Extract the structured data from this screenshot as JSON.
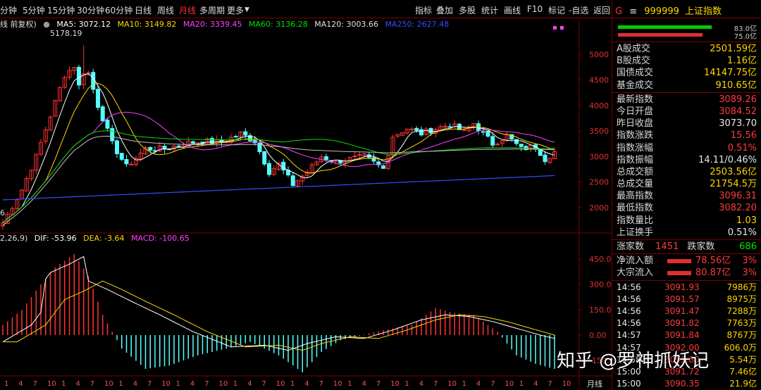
{
  "toolbar": {
    "left_items": [
      "分钟",
      "5分钟",
      "15分钟",
      "30分钟",
      "60分钟",
      "日线",
      "周线",
      "月线",
      "多周期",
      "更多"
    ],
    "active": "月线",
    "right_items": [
      "指标",
      "叠加",
      "多股",
      "统计",
      "画线",
      "F10",
      "标记",
      "-自选",
      "返回"
    ]
  },
  "price_legend": {
    "prefix": "线 前复权)",
    "ma5": "MA5: 3072.12",
    "ma10": "MA10: 3149.82",
    "ma20": "MA20: 3339.45",
    "ma60": "MA60: 3136.28",
    "ma120": "MA120: 3003.66",
    "ma250": "MA250: 2627.48",
    "peak_label": "5178.19",
    "low_label": "6"
  },
  "macd_legend": {
    "prefix": "2,26,9)",
    "dif": "DIF: -53.96",
    "dea": "DEA: -3.64",
    "macd": "MACD: -100.65"
  },
  "price_axis": [
    "5000",
    "4500",
    "4000",
    "3500",
    "3000",
    "2500",
    "2000"
  ],
  "macd_axis": [
    "450.0",
    "300.0",
    "150.0",
    "0.00",
    "-150.0"
  ],
  "x_axis": [
    "1",
    "4",
    "7",
    "10",
    "1",
    "4",
    "7",
    "10",
    "1",
    "4",
    "7",
    "10",
    "1",
    "4",
    "7",
    "10",
    "1",
    "4",
    "7",
    "10",
    "1",
    "4",
    "7",
    "10",
    "1",
    "4",
    "7",
    "10",
    "1",
    "4",
    "7",
    "10",
    "1",
    "4",
    "7",
    "10",
    "1",
    "4",
    "7",
    "10"
  ],
  "period_label": "月线",
  "panel": {
    "g": "G",
    "menu": "≡",
    "code": "999999",
    "name": "上证指数",
    "strength": [
      {
        "color": "#00cc00",
        "fraction": 0.83,
        "pct": "83.0亿"
      },
      {
        "color": "#e03030",
        "fraction": 0.75,
        "pct": "75.0亿"
      }
    ],
    "volume_rows": [
      {
        "label": "A股成交",
        "value": "2501.59亿"
      },
      {
        "label": "B股成交",
        "value": "1.16亿"
      },
      {
        "label": "国债成交",
        "value": "14147.75亿"
      },
      {
        "label": "基金成交",
        "value": "910.65亿"
      }
    ],
    "index_rows": [
      {
        "label": "最新指数",
        "value": "3089.26",
        "color": "red"
      },
      {
        "label": "今日开盘",
        "value": "3084.52",
        "color": "red"
      },
      {
        "label": "昨日收盘",
        "value": "3073.70",
        "color": "white"
      },
      {
        "label": "指数涨跌",
        "value": "15.56",
        "color": "red"
      },
      {
        "label": "指数涨幅",
        "value": "0.51%",
        "color": "red"
      },
      {
        "label": "指数振幅",
        "value": "14.11/0.46%",
        "color": "white"
      },
      {
        "label": "总成交额",
        "value": "2503.56亿",
        "color": "yellow"
      },
      {
        "label": "总成交量",
        "value": "21754.5万",
        "color": "yellow"
      },
      {
        "label": "最高指数",
        "value": "3096.31",
        "color": "red"
      },
      {
        "label": "最低指数",
        "value": "3082.20",
        "color": "red"
      },
      {
        "label": "指数量比",
        "value": "1.03",
        "color": "yellow"
      },
      {
        "label": "上证换手",
        "value": "0.51%",
        "color": "white"
      }
    ],
    "breadth": {
      "up_label": "涨家数",
      "up_value": "1451",
      "down_label": "跌家数",
      "down_value": "686"
    },
    "flows": [
      {
        "label": "净流入额",
        "value": "78.56亿",
        "pct": "3%"
      },
      {
        "label": "大宗流入",
        "value": "80.87亿",
        "pct": "3%"
      }
    ],
    "ticks": [
      {
        "time": "14:56",
        "price": "3091.93",
        "vol": "7986万"
      },
      {
        "time": "14:56",
        "price": "3091.57",
        "vol": "8975万"
      },
      {
        "time": "14:56",
        "price": "3091.47",
        "vol": "7288万"
      },
      {
        "time": "14:56",
        "price": "3091.82",
        "vol": "7763万"
      },
      {
        "time": "14:57",
        "price": "3091.84",
        "vol": "8767万"
      },
      {
        "time": "14:57",
        "price": "3092.00",
        "vol": "606.0万"
      },
      {
        "time": "14:58",
        "price": "3091.80",
        "vol": "5.54万"
      },
      {
        "time": "15:00",
        "price": "3091.72",
        "vol": "7.46亿"
      },
      {
        "time": "15:00",
        "price": "3090.35",
        "vol": "21.9亿"
      }
    ]
  },
  "watermark": "知乎 @罗神抓妖记",
  "colors": {
    "up": "#ff3232",
    "down": "#54ffff",
    "ma5": "#ffffff",
    "ma10": "#ffd700",
    "ma20": "#ff40ff",
    "ma60": "#00e000",
    "ma120": "#c0c0c0",
    "ma250": "#3050ff",
    "grid": "#7a0000",
    "dif": "#ffffff",
    "dea": "#ffd700"
  }
}
